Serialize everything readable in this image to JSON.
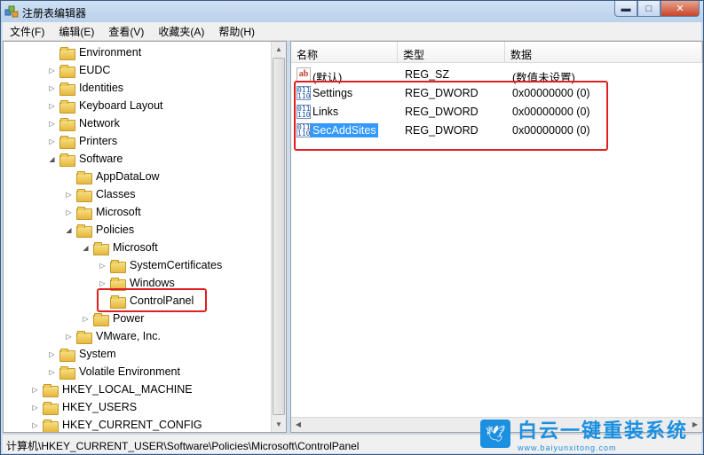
{
  "window": {
    "title": "注册表编辑器",
    "minimize": "▬",
    "maximize": "□",
    "close": "✕",
    "app_icon": "regedit-icon"
  },
  "menu": [
    "文件(F)",
    "编辑(E)",
    "查看(V)",
    "收藏夹(A)",
    "帮助(H)"
  ],
  "tree": [
    {
      "label": "Environment",
      "expander": ""
    },
    {
      "label": "EUDC",
      "expander": "▷"
    },
    {
      "label": "Identities",
      "expander": "▷"
    },
    {
      "label": "Keyboard Layout",
      "expander": "▷"
    },
    {
      "label": "Network",
      "expander": "▷"
    },
    {
      "label": "Printers",
      "expander": "▷"
    },
    {
      "label": "Software",
      "expander": "◢"
    },
    {
      "label": "AppDataLow",
      "expander": ""
    },
    {
      "label": "Classes",
      "expander": "▷"
    },
    {
      "label": "Microsoft",
      "expander": "▷"
    },
    {
      "label": "Policies",
      "expander": "◢"
    },
    {
      "label": "Microsoft",
      "expander": "◢"
    },
    {
      "label": "SystemCertificates",
      "expander": "▷"
    },
    {
      "label": "Windows",
      "expander": "▷"
    },
    {
      "label": "ControlPanel",
      "expander": ""
    },
    {
      "label": "Power",
      "expander": "▷"
    },
    {
      "label": "VMware, Inc.",
      "expander": "▷"
    },
    {
      "label": "System",
      "expander": "▷"
    },
    {
      "label": "Volatile Environment",
      "expander": "▷"
    },
    {
      "label": "HKEY_LOCAL_MACHINE",
      "expander": "▷"
    },
    {
      "label": "HKEY_USERS",
      "expander": "▷"
    },
    {
      "label": "HKEY_CURRENT_CONFIG",
      "expander": "▷"
    }
  ],
  "columns": {
    "name": "名称",
    "type": "类型",
    "data": "数据"
  },
  "values": [
    {
      "name": "(默认)",
      "type": "REG_SZ",
      "data": "(数值未设置)",
      "icon": "ab",
      "icon_name": "string-value-icon"
    },
    {
      "name": "Settings",
      "type": "REG_DWORD",
      "data": "0x00000000 (0)",
      "icon": "011\n110",
      "icon_name": "dword-value-icon"
    },
    {
      "name": "Links",
      "type": "REG_DWORD",
      "data": "0x00000000 (0)",
      "icon": "011\n110",
      "icon_name": "dword-value-icon"
    },
    {
      "name": "SecAddSites",
      "type": "REG_DWORD",
      "data": "0x00000000 (0)",
      "icon": "011\n110",
      "icon_name": "dword-value-icon",
      "selected": true
    }
  ],
  "status": "计算机\\HKEY_CURRENT_USER\\Software\\Policies\\Microsoft\\ControlPanel",
  "watermark": {
    "main": "白云一键重装系统",
    "sub": "www.baiyunxitong.com",
    "icon": "bird-icon"
  },
  "colors": {
    "selection": "#3399ff",
    "highlight_box": "#e02020",
    "watermark": "#1b8fe0"
  }
}
